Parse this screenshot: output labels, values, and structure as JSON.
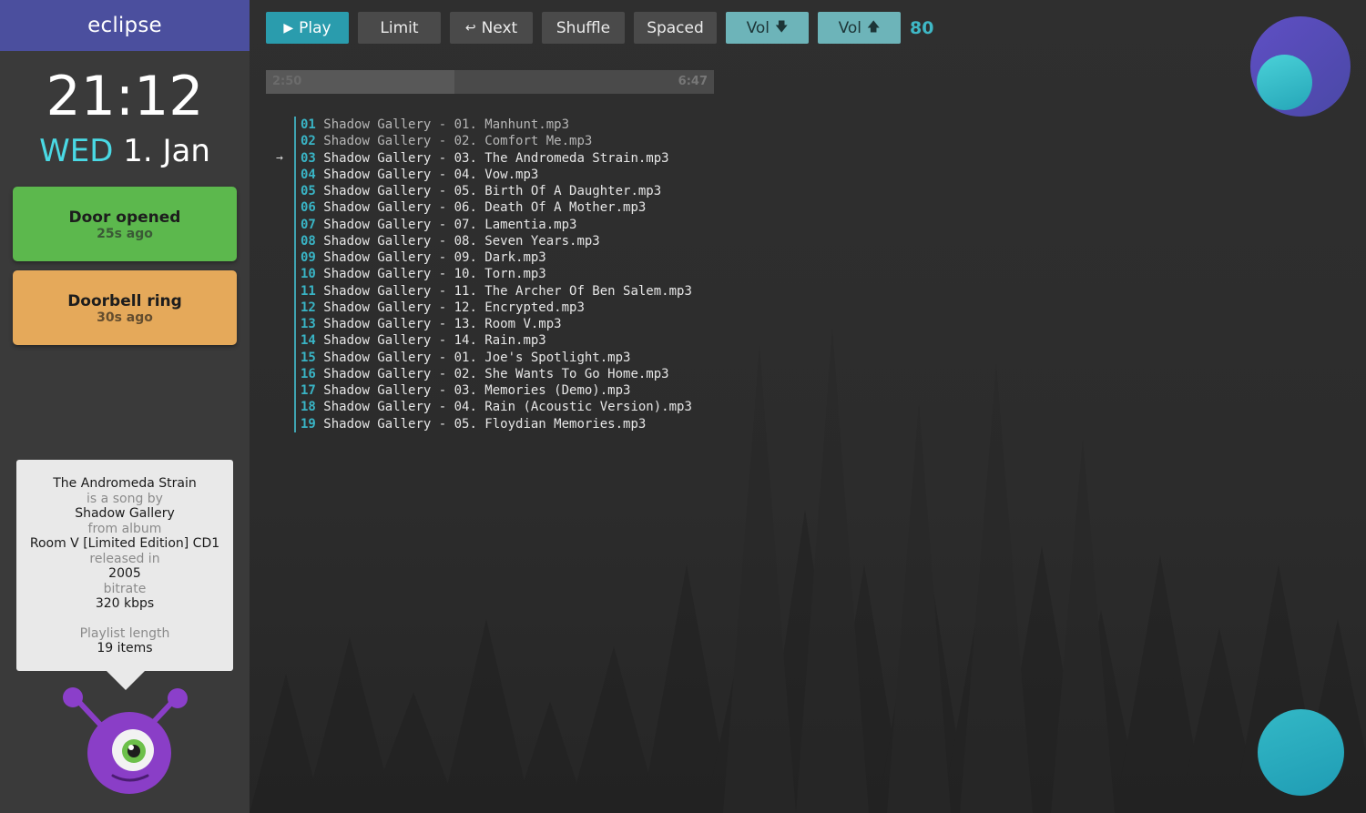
{
  "sidebar": {
    "brand": "eclipse",
    "clock": "21:12",
    "date_dow": "WED",
    "date_rest": "1. Jan",
    "events": [
      {
        "title": "Door opened",
        "time": "25s ago",
        "color": "#5cb84d"
      },
      {
        "title": "Doorbell ring",
        "time": "30s ago",
        "color": "#e5a95a"
      }
    ],
    "info": {
      "song": "The Andromeda Strain",
      "song_label": "is a song by",
      "artist": "Shadow Gallery",
      "album_label": "from album",
      "album": "Room V [Limited Edition] CD1",
      "released_label": "released in",
      "year": "2005",
      "bitrate_label": "bitrate",
      "bitrate": "320 kbps",
      "playlist_label": "Playlist length",
      "playlist_length": "19 items"
    }
  },
  "toolbar": {
    "play": "Play",
    "limit": "Limit",
    "next": "Next",
    "shuffle": "Shuffle",
    "spaced": "Spaced",
    "vol_down": "Vol",
    "vol_up": "Vol",
    "volume": "80"
  },
  "progress": {
    "elapsed": "2:50",
    "total": "6:47",
    "fraction": 0.42
  },
  "playlist": {
    "current_index": 2,
    "arrow": "→",
    "tracks": [
      {
        "num": "01",
        "title": "Shadow Gallery - 01. Manhunt.mp3"
      },
      {
        "num": "02",
        "title": "Shadow Gallery - 02. Comfort Me.mp3"
      },
      {
        "num": "03",
        "title": "Shadow Gallery - 03. The Andromeda Strain.mp3"
      },
      {
        "num": "04",
        "title": "Shadow Gallery - 04. Vow.mp3"
      },
      {
        "num": "05",
        "title": "Shadow Gallery - 05. Birth Of A Daughter.mp3"
      },
      {
        "num": "06",
        "title": "Shadow Gallery - 06. Death Of A Mother.mp3"
      },
      {
        "num": "07",
        "title": "Shadow Gallery - 07. Lamentia.mp3"
      },
      {
        "num": "08",
        "title": "Shadow Gallery - 08. Seven Years.mp3"
      },
      {
        "num": "09",
        "title": "Shadow Gallery - 09. Dark.mp3"
      },
      {
        "num": "10",
        "title": "Shadow Gallery - 10. Torn.mp3"
      },
      {
        "num": "11",
        "title": "Shadow Gallery - 11. The Archer Of Ben Salem.mp3"
      },
      {
        "num": "12",
        "title": "Shadow Gallery - 12. Encrypted.mp3"
      },
      {
        "num": "13",
        "title": "Shadow Gallery - 13. Room V.mp3"
      },
      {
        "num": "14",
        "title": "Shadow Gallery - 14. Rain.mp3"
      },
      {
        "num": "15",
        "title": "Shadow Gallery - 01. Joe's Spotlight.mp3"
      },
      {
        "num": "16",
        "title": "Shadow Gallery - 02. She Wants To Go Home.mp3"
      },
      {
        "num": "17",
        "title": "Shadow Gallery - 03. Memories (Demo).mp3"
      },
      {
        "num": "18",
        "title": "Shadow Gallery - 04. Rain (Acoustic Version).mp3"
      },
      {
        "num": "19",
        "title": "Shadow Gallery - 05. Floydian Memories.mp3"
      }
    ]
  },
  "icons": {
    "play": "play-icon",
    "next": "undo-arrow-icon",
    "vol_down": "arrow-down-icon",
    "vol_up": "arrow-up-icon",
    "mascot": "purple-monster-icon"
  },
  "colors": {
    "brand_bar": "#4b4f9e",
    "accent": "#2a9cad",
    "volume_buttons": "#6db4b9",
    "track_number": "#39b4c5",
    "date_dow": "#4ad9e4"
  }
}
